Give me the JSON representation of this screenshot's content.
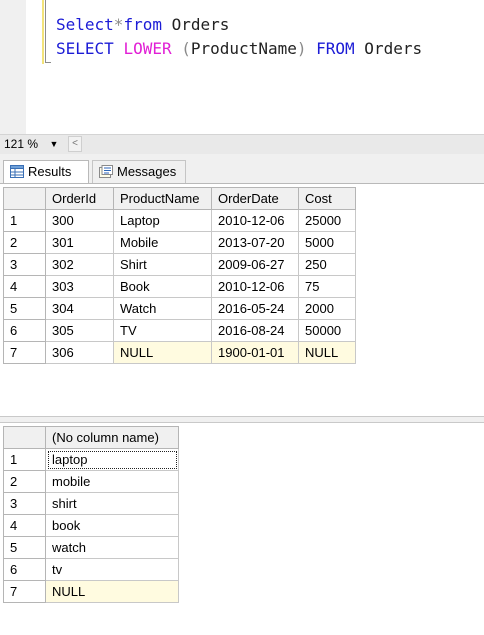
{
  "editor": {
    "line1": {
      "kw1": "Select",
      "op1": "*",
      "kw2": "from",
      "id1": " Orders"
    },
    "line2": {
      "kw1": "SELECT",
      "fn": "LOWER",
      "op1": "(",
      "id1": "ProductName",
      "op2": ")",
      "kw2": "FROM",
      "id2": " Orders"
    }
  },
  "zoom": {
    "value": "121 %",
    "dropdown_glyph": "▼",
    "scroll_left_glyph": "<"
  },
  "tabs": {
    "results": {
      "label": "Results",
      "icon": "grid-icon"
    },
    "messages": {
      "label": "Messages",
      "icon": "messages-icon"
    }
  },
  "grid1": {
    "columns": [
      "OrderId",
      "ProductName",
      "OrderDate",
      "Cost"
    ],
    "rows": [
      [
        "1",
        "300",
        "Laptop",
        "2010-12-06",
        "25000"
      ],
      [
        "2",
        "301",
        "Mobile",
        "2013-07-20",
        "5000"
      ],
      [
        "3",
        "302",
        "Shirt",
        "2009-06-27",
        "250"
      ],
      [
        "4",
        "303",
        "Book",
        "2010-12-06",
        "75"
      ],
      [
        "5",
        "304",
        "Watch",
        "2016-05-24",
        "2000"
      ],
      [
        "6",
        "305",
        "TV",
        "2016-08-24",
        "50000"
      ],
      [
        "7",
        "306",
        "NULL",
        "1900-01-01",
        "NULL"
      ]
    ]
  },
  "grid2": {
    "columns": [
      "(No column name)"
    ],
    "rows": [
      [
        "1",
        "laptop"
      ],
      [
        "2",
        "mobile"
      ],
      [
        "3",
        "shirt"
      ],
      [
        "4",
        "book"
      ],
      [
        "5",
        "watch"
      ],
      [
        "6",
        "tv"
      ],
      [
        "7",
        "NULL"
      ]
    ]
  },
  "colors": {
    "keyword": "#1c1cd6",
    "function": "#e11fd5",
    "null_cell": "#fffbe0",
    "header": "#f0f0f0"
  }
}
